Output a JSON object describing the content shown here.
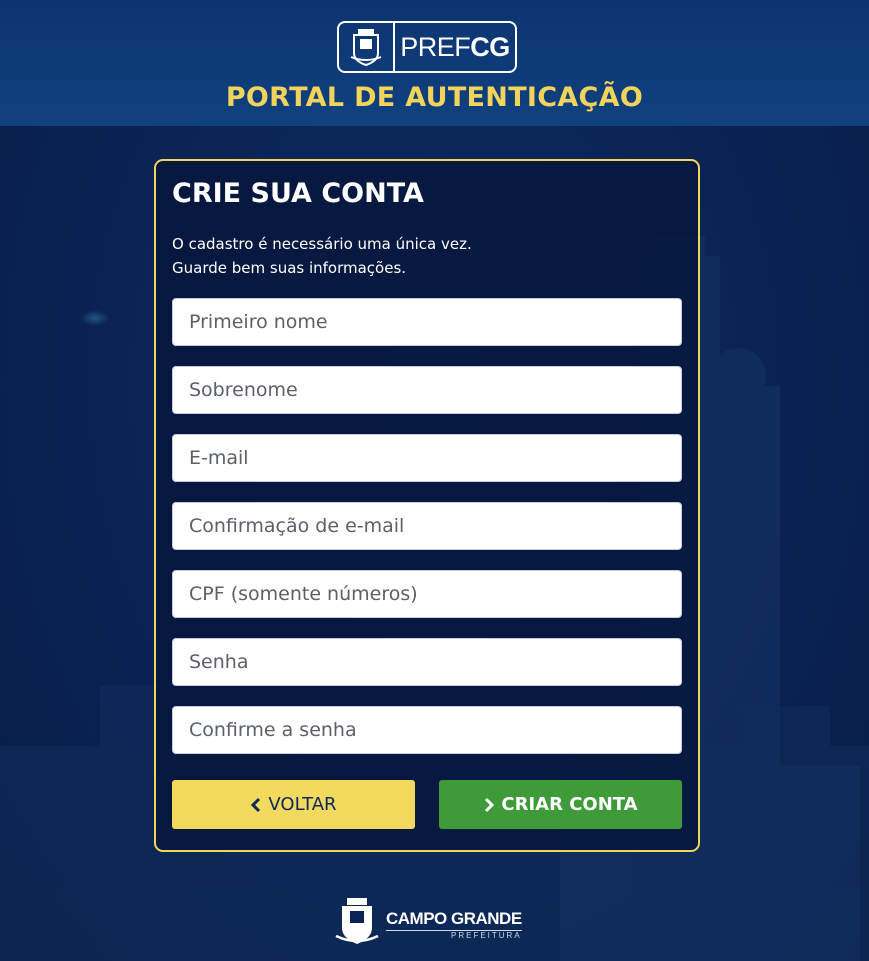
{
  "header": {
    "logo": {
      "text_light": "PREF",
      "text_bold": "CG"
    },
    "title": "PORTAL DE AUTENTICAÇÃO"
  },
  "form": {
    "title": "CRIE SUA CONTA",
    "description_line1": "O cadastro é necessário uma única vez.",
    "description_line2": "Guarde bem suas informações.",
    "fields": [
      {
        "placeholder": "Primeiro nome",
        "value": ""
      },
      {
        "placeholder": "Sobrenome",
        "value": ""
      },
      {
        "placeholder": "E-mail",
        "value": ""
      },
      {
        "placeholder": "Confirmação de e-mail",
        "value": ""
      },
      {
        "placeholder": "CPF (somente números)",
        "value": ""
      },
      {
        "placeholder": "Senha",
        "value": ""
      },
      {
        "placeholder": "Confirme a senha",
        "value": ""
      }
    ],
    "back_button": {
      "label": "VOLTAR",
      "icon": "chevron-left-icon"
    },
    "create_button": {
      "label": "CRIAR CONTA",
      "icon": "chevron-right-icon"
    }
  },
  "footer": {
    "city_name": "CAMPO GRANDE",
    "subtitle": "PREFEITURA"
  },
  "colors": {
    "accent_yellow": "#f2d45c",
    "button_green": "#3f9a3a",
    "background_navy": "#0a2455"
  }
}
